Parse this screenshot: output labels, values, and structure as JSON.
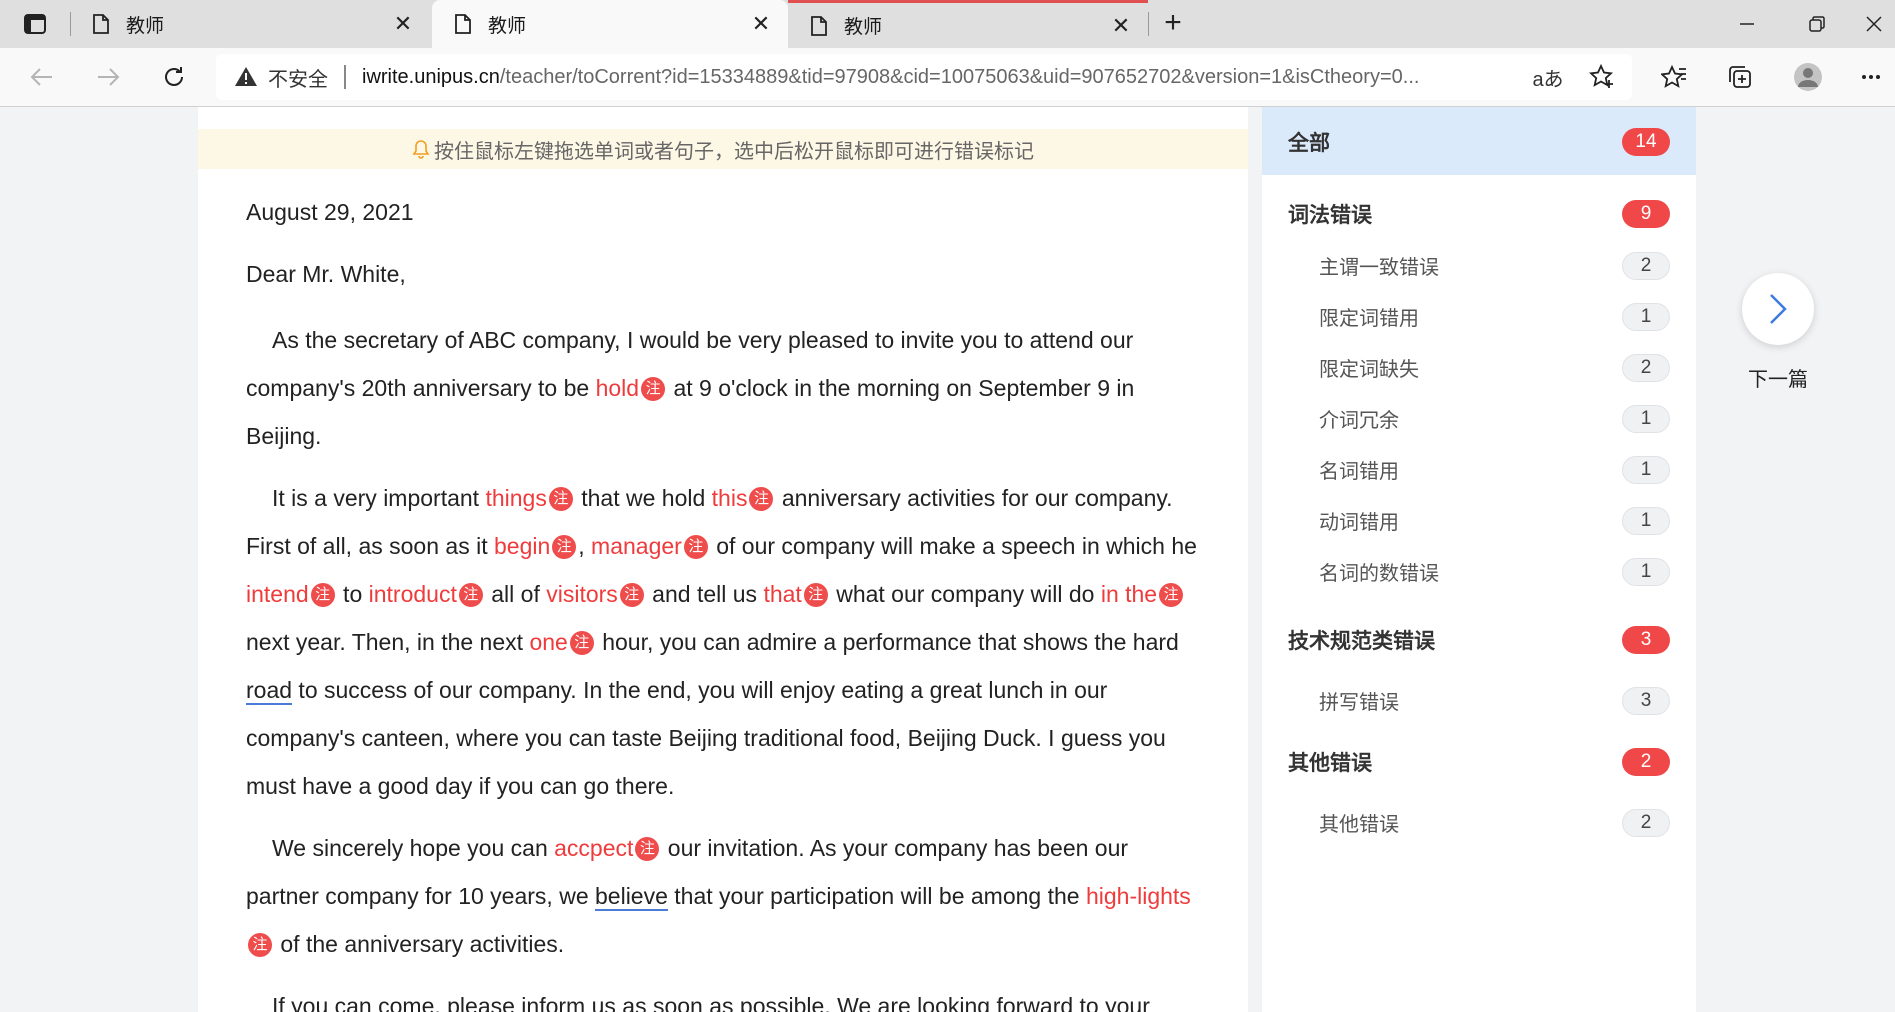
{
  "browser": {
    "tabs": [
      {
        "label": "教师",
        "active": false
      },
      {
        "label": "教师",
        "active": true
      },
      {
        "label": "教师",
        "active": false
      }
    ],
    "security_label": "不安全",
    "url_host": "iwrite.unipus.cn",
    "url_path": "/teacher/toCorrent?id=15334889&tid=97908&cid=10075063&uid=907652702&version=1&isCtheory=0..."
  },
  "hint": "按住鼠标左键拖选单词或者句子，选中后松开鼠标即可进行错误标记",
  "letter": {
    "date": "August 29, 2021",
    "greeting": "Dear Mr. White,",
    "note_mark": "注",
    "p1": {
      "a": "As the secretary of ABC company, I would be very pleased to invite you to attend our company's 20th anniversary to be ",
      "e1": "hold",
      "b": " at 9 o'clock in the morning on September 9 in Beijing."
    },
    "p2": {
      "a": "It is a very important ",
      "e1": "things",
      "b": " that we hold ",
      "e2": "this",
      "c": " anniversary activities for our company. First of all, as soon as it ",
      "e3": "begin",
      "d": ", ",
      "e4": "manager",
      "e": " of our company will make a speech in which he ",
      "e5": "intend",
      "f": " to ",
      "e6": "introduct",
      "g": " all of ",
      "e7": "visitors",
      "h": " and tell us ",
      "e8": "that",
      "i": " what our company will do ",
      "e9": "in the",
      "j": " next year. Then, in the next ",
      "e10": "one",
      "k": " hour, you can admire a performance that shows the hard ",
      "u1": "road",
      "l": " to success of our company. In the end, you will enjoy eating a great lunch in our company's canteen, where you can taste Beijing traditional food, Beijing Duck. I guess you must have a good day if you can go there."
    },
    "p3": {
      "a": "We sincerely hope you can ",
      "e1": "accpect",
      "b": " our invitation. As your company has been our partner company for 10 years, we ",
      "u1": "believe",
      "c": " that your participation will be among the ",
      "e2": "high-lights",
      "d": " of the anniversary activities."
    },
    "p4": "If you can come, please inform us as soon as possible. We are looking forward to your"
  },
  "sidebar": {
    "all": {
      "label": "全部",
      "count": "14"
    },
    "categories": [
      {
        "label": "词法错误",
        "count": "9",
        "items": [
          {
            "label": "主谓一致错误",
            "count": "2"
          },
          {
            "label": "限定词错用",
            "count": "1"
          },
          {
            "label": "限定词缺失",
            "count": "2"
          },
          {
            "label": "介词冗余",
            "count": "1"
          },
          {
            "label": "名词错用",
            "count": "1"
          },
          {
            "label": "动词错用",
            "count": "1"
          },
          {
            "label": "名词的数错误",
            "count": "1"
          }
        ]
      },
      {
        "label": "技术规范类错误",
        "count": "3",
        "items": [
          {
            "label": "拼写错误",
            "count": "3"
          }
        ]
      },
      {
        "label": "其他错误",
        "count": "2",
        "items": [
          {
            "label": "其他错误",
            "count": "2"
          }
        ]
      }
    ]
  },
  "next": {
    "label": "下一篇"
  },
  "colors": {
    "error": "#ef3b3b",
    "badge": "#f04848",
    "selected_bg": "#dbeafb",
    "hint_bg": "#fdf7e6"
  }
}
